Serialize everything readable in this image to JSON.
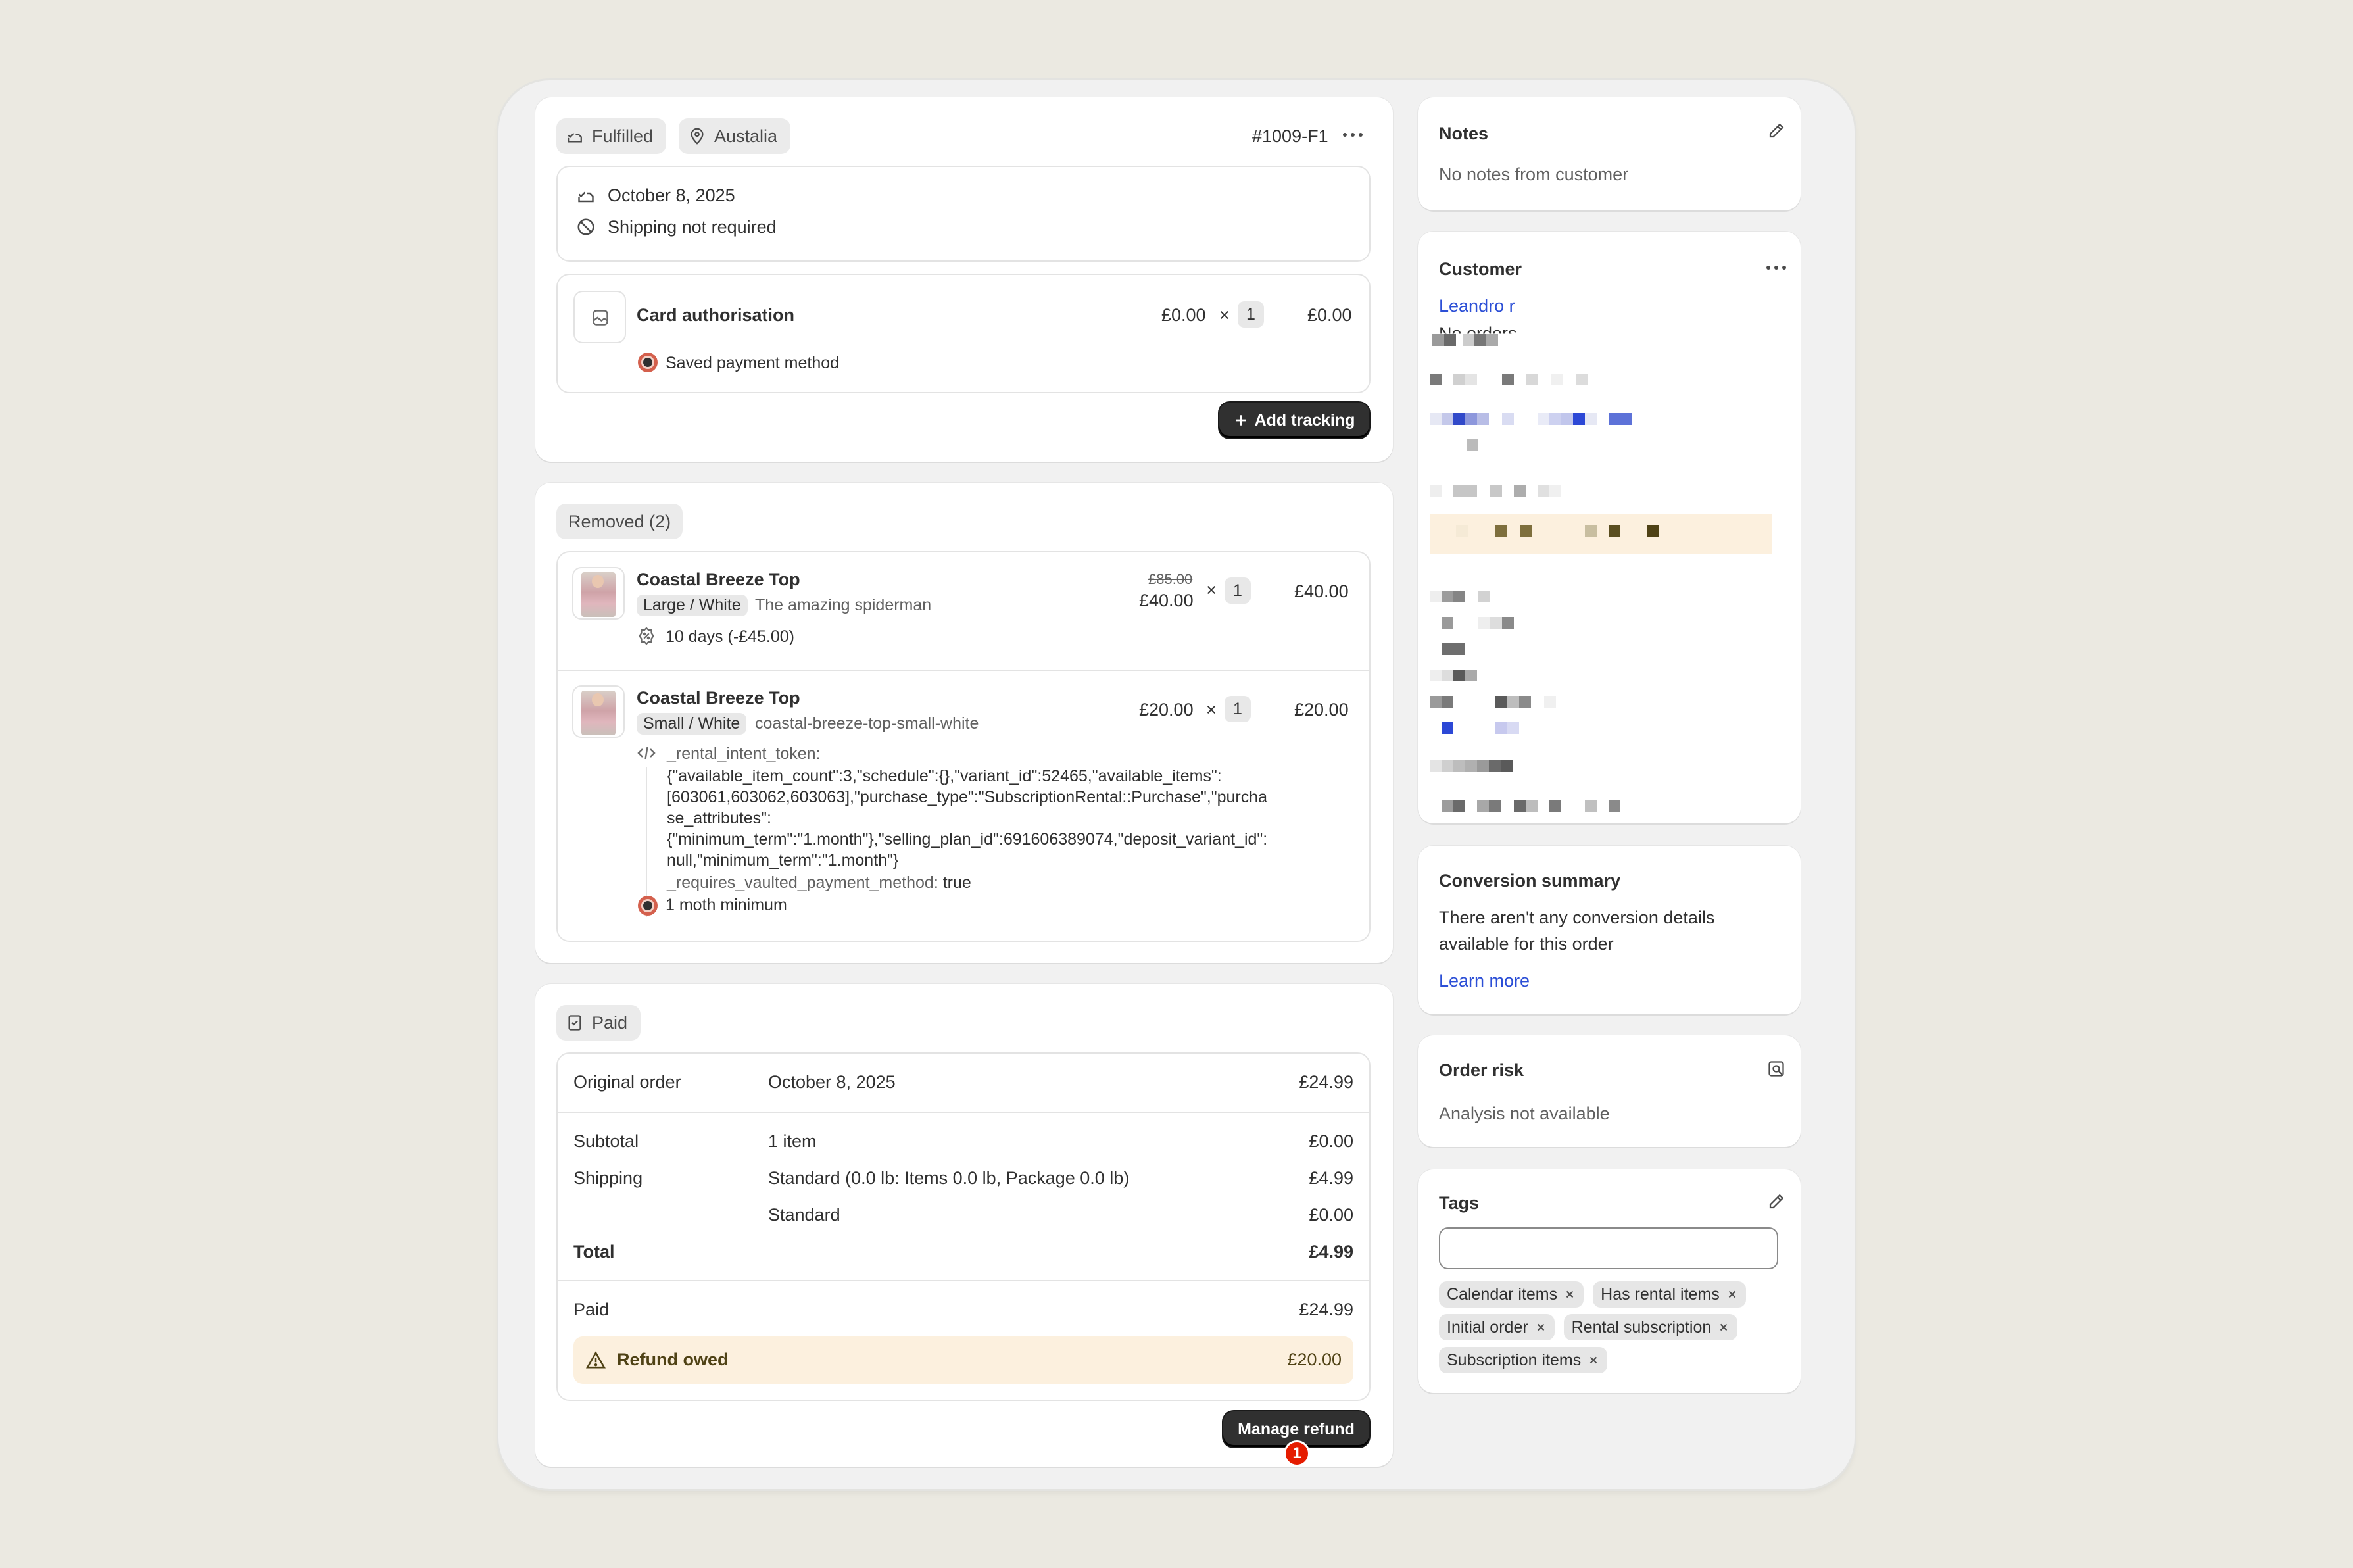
{
  "fulfillment": {
    "status_badge": "Fulfilled",
    "location_badge": "Austalia",
    "order_number": "#1009-F1",
    "date": "October 8, 2025",
    "shipping_note": "Shipping not required",
    "item": {
      "name": "Card authorisation",
      "unit_price": "£0.00",
      "times": "×",
      "quantity": "1",
      "total": "£0.00",
      "payment_method": "Saved payment method"
    },
    "add_tracking_label": "Add tracking"
  },
  "removed": {
    "badge": "Removed (2)",
    "items": [
      {
        "name": "Coastal Breeze Top",
        "variant": "Large / White",
        "sku": "The amazing spiderman",
        "original_price": "£85.00",
        "price": "£40.00",
        "times": "×",
        "quantity": "1",
        "total": "£40.00",
        "discount": "10 days (-£45.00)"
      },
      {
        "name": "Coastal Breeze Top",
        "variant": "Small / White",
        "sku": "coastal-breeze-top-small-white",
        "price": "£20.00",
        "times": "×",
        "quantity": "1",
        "total": "£20.00",
        "property_key": "_rental_intent_token:",
        "property_lines": [
          "{\"available_item_count\":3,\"schedule\":{},\"variant_id\":52465,\"available_items\":",
          "[603061,603062,603063],\"purchase_type\":\"SubscriptionRental::Purchase\",\"purcha",
          "se_attributes\":",
          "{\"minimum_term\":\"1.month\"},\"selling_plan_id\":691606389074,\"deposit_variant_id\":",
          "null,\"minimum_term\":\"1.month\"}"
        ],
        "vaulted_key": "_requires_vaulted_payment_method:",
        "vaulted_value": "true",
        "minimum": "1 moth minimum"
      }
    ]
  },
  "payment": {
    "badge": "Paid",
    "original_order_label": "Original order",
    "original_order_date": "October 8, 2025",
    "original_order_amount": "£24.99",
    "subtotal_label": "Subtotal",
    "subtotal_desc": "1 item",
    "subtotal_amount": "£0.00",
    "shipping_label": "Shipping",
    "shipping_desc": "Standard (0.0 lb: Items 0.0 lb, Package 0.0 lb)",
    "shipping_amount": "£4.99",
    "shipping_desc_2": "Standard",
    "shipping_amount_2": "£0.00",
    "total_label": "Total",
    "total_amount": "£4.99",
    "paid_label": "Paid",
    "paid_amount": "£24.99",
    "refund_label": "Refund owed",
    "refund_amount": "£20.00",
    "manage_refund_label": "Manage refund",
    "notification_count": "1"
  },
  "notes": {
    "title": "Notes",
    "text": "No notes from customer"
  },
  "customer": {
    "title": "Customer",
    "name": "Leandro r",
    "orders": "No orders"
  },
  "conversion": {
    "title": "Conversion summary",
    "text_line1": "There aren't any conversion details",
    "text_line2": "available for this order",
    "learn_more": "Learn more"
  },
  "risk": {
    "title": "Order risk",
    "text": "Analysis not available"
  },
  "tags": {
    "title": "Tags",
    "input_value": "",
    "items": [
      "Calendar items",
      "Has rental items",
      "Initial order",
      "Rental subscription",
      "Subscription items"
    ]
  },
  "colors": {
    "page_bg": "#ebe9e1",
    "frame_bg": "#f1f1f1",
    "button_dark": "#303030",
    "link_blue": "#2c4fd6",
    "refund_bg": "#fcf0de",
    "notification_red": "#e51c00"
  }
}
